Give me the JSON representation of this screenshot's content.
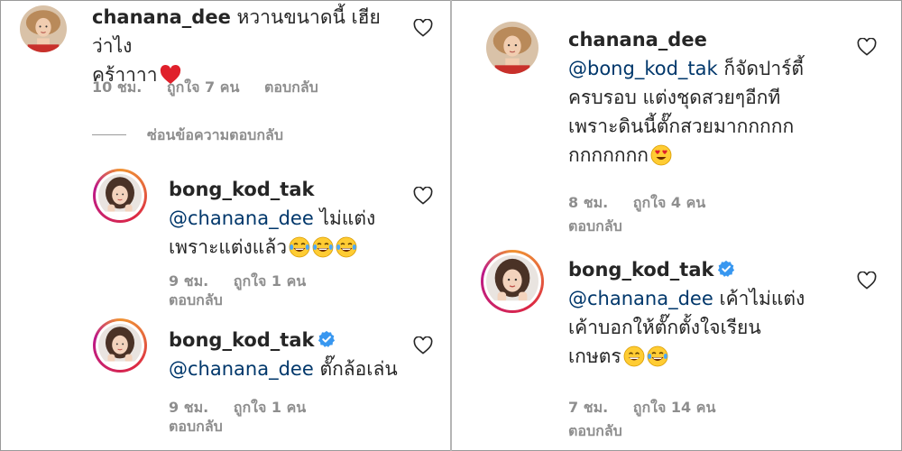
{
  "left": {
    "comment": {
      "username": "chanana_dee",
      "text_line1": "หวานขนาดนี้ เฮียว่าไง",
      "text_line2": "คร้าาาา",
      "time": "10 ชม.",
      "likes": "ถูกใจ 7 คน",
      "reply": "ตอบกลับ"
    },
    "hide_replies": "ซ่อนข้อความตอบกลับ",
    "replies": [
      {
        "username": "bong_kod_tak",
        "mention": "@chanana_dee",
        "text_line1": "ไม่แต่ง",
        "text_line2": "เพราะแต่งแล้ว",
        "time": "9 ชม.",
        "likes": "ถูกใจ 1 คน",
        "reply": "ตอบกลับ"
      },
      {
        "username": "bong_kod_tak",
        "mention": "@chanana_dee",
        "text_line1": "ตั๊กล้อเล่น",
        "time": "9 ชม.",
        "likes": "ถูกใจ 1 คน",
        "reply": "ตอบกลับ"
      }
    ]
  },
  "right": {
    "comments": [
      {
        "username": "chanana_dee",
        "mention": "@bong_kod_tak",
        "text_line1": "ก็จัดปาร์ตี้",
        "text_line2": "ครบรอบ แต่งชุดสวยๆอีกที",
        "text_line3": "เพราะดินนี้ตั๊กสวยมากกกกก",
        "text_line4": "กกกกกกก",
        "time": "8 ชม.",
        "likes": "ถูกใจ 4 คน",
        "reply": "ตอบกลับ"
      },
      {
        "username": "bong_kod_tak",
        "mention": "@chanana_dee",
        "text_line1": "เค้าไม่แต่ง",
        "text_line2": "เค้าบอกให้ตั๊กตั้งใจเรียน",
        "text_line3": "เกษตร",
        "time": "7 ชม.",
        "likes": "ถูกใจ 14 คน",
        "reply": "ตอบกลับ"
      }
    ]
  },
  "colors": {
    "text": "#262626",
    "mention": "#00376b",
    "meta": "#8e8e8e",
    "verified": "#3897f0",
    "heart_red": "#e0202b"
  },
  "icons": [
    "heart-outline-icon",
    "verified-badge-icon",
    "red-heart-emoji-icon",
    "laughing-tears-emoji-icon",
    "heart-eyes-emoji-icon",
    "grinning-emoji-icon"
  ]
}
